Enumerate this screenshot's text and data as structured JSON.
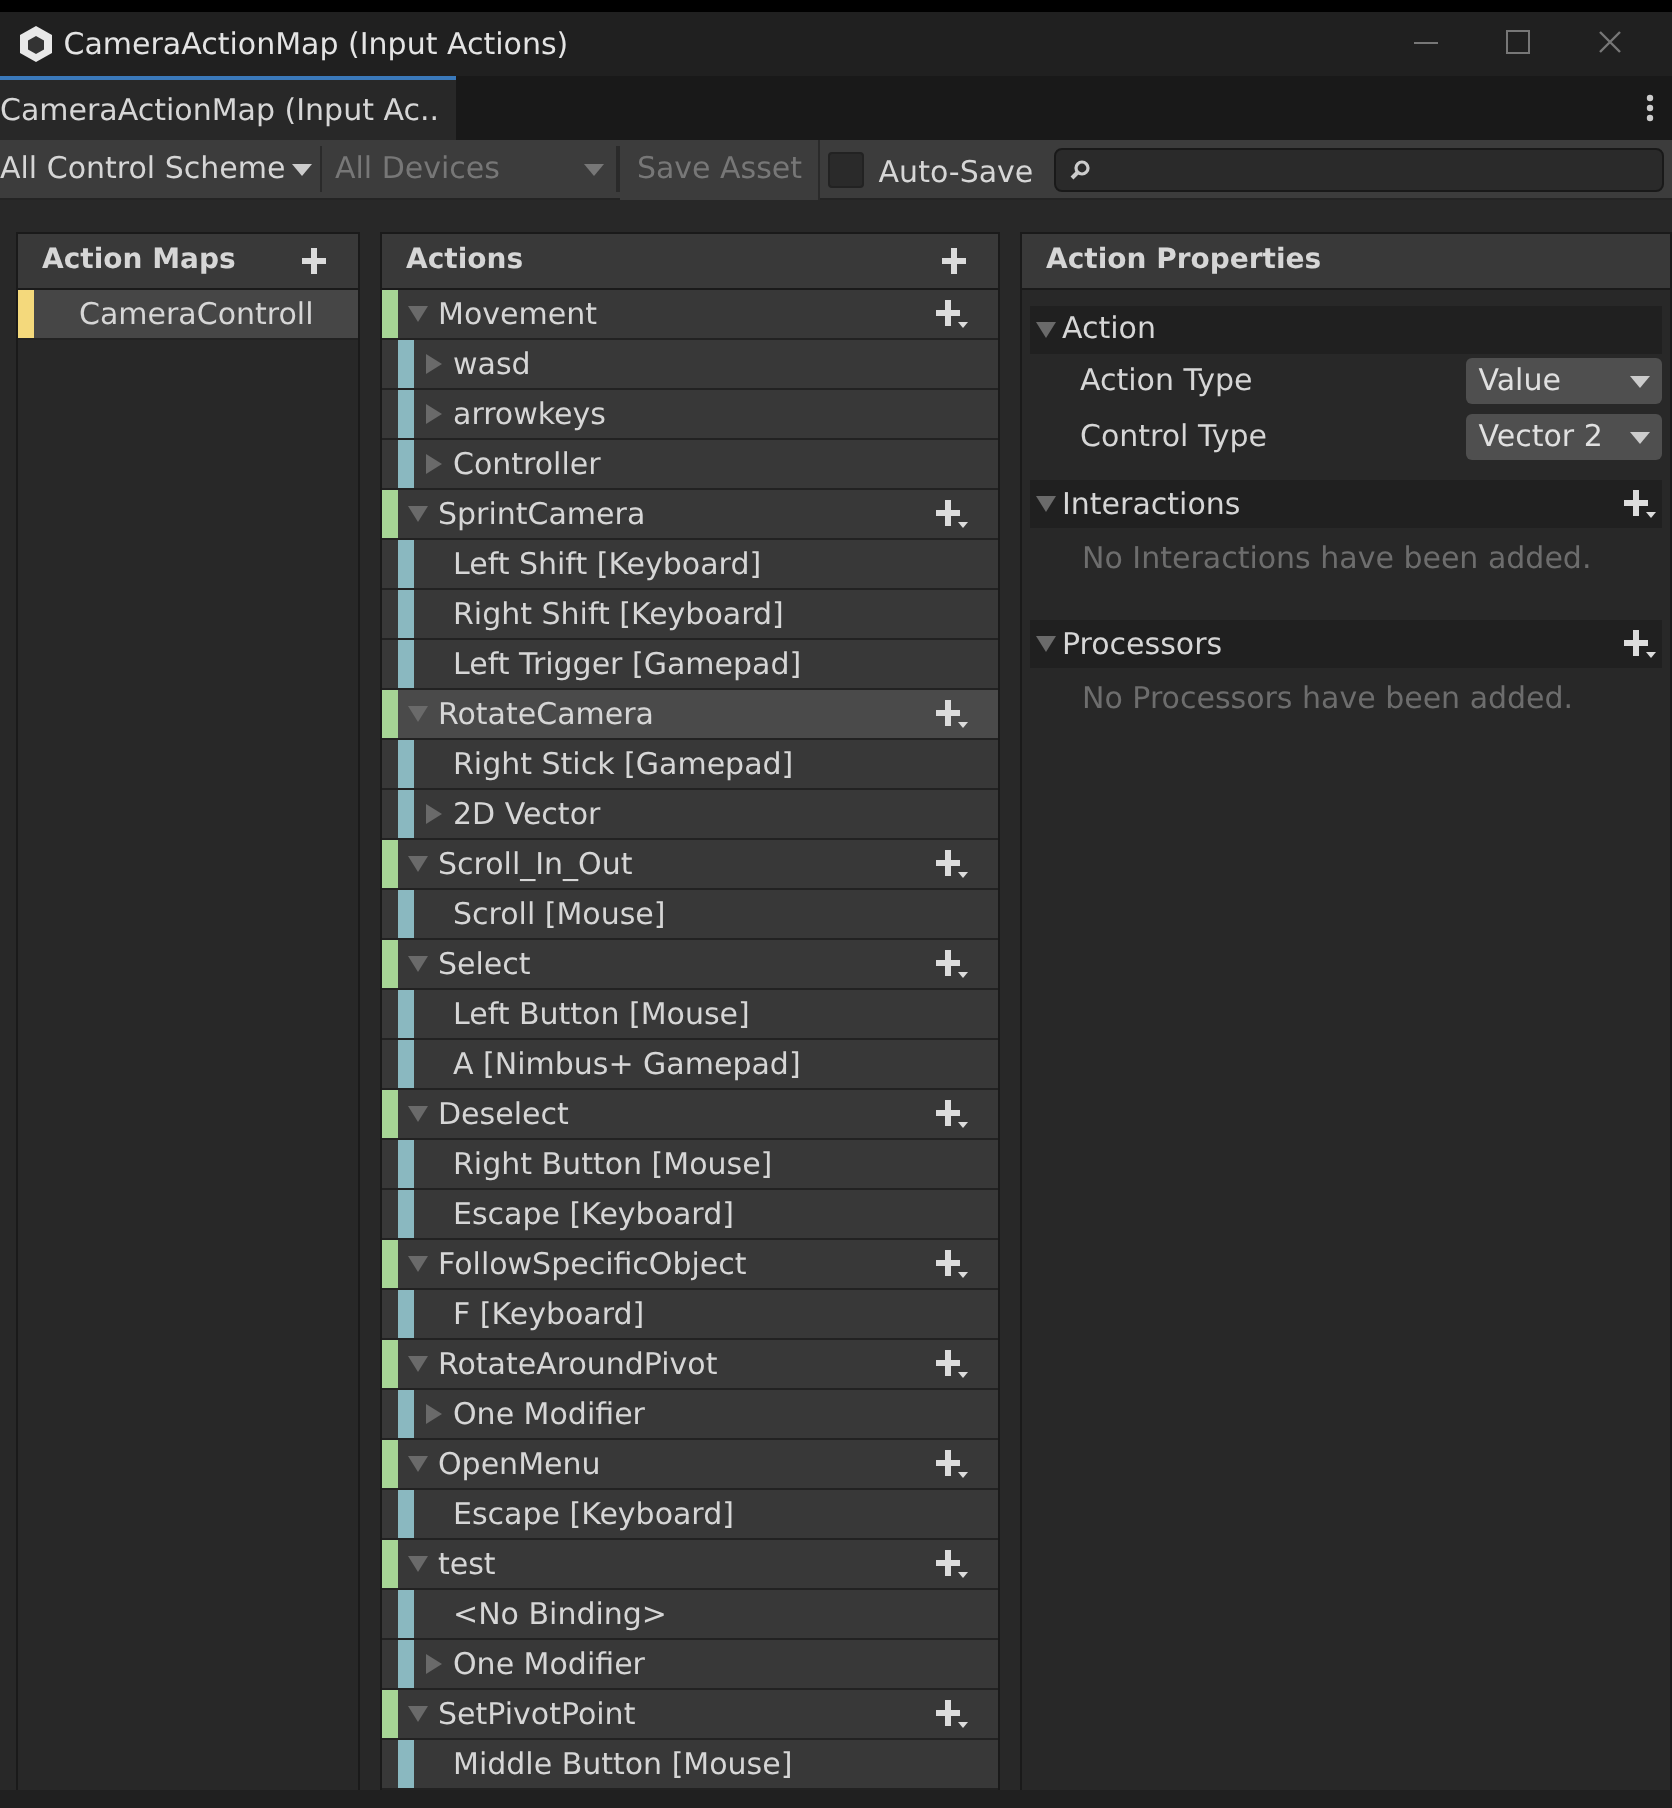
{
  "window": {
    "title": "CameraActionMap (Input Actions)"
  },
  "tabs": [
    {
      "label": "CameraActionMap (Input Ac..",
      "selected": true
    }
  ],
  "toolbar": {
    "control_scheme": "All Control Scheme",
    "devices": "All Devices",
    "save_button": "Save Asset",
    "auto_save": {
      "label": "Auto-Save",
      "checked": false
    }
  },
  "action_maps": {
    "title": "Action Maps",
    "items": [
      {
        "label": "CameraControll",
        "selected": true
      }
    ]
  },
  "actions": {
    "title": "Actions",
    "items": [
      {
        "label": "Movement",
        "expanded": true,
        "selected": false,
        "children": [
          {
            "kind": "composite",
            "label": "wasd",
            "expanded": false
          },
          {
            "kind": "composite",
            "label": "arrowkeys",
            "expanded": false
          },
          {
            "kind": "composite",
            "label": "Controller",
            "expanded": false
          }
        ]
      },
      {
        "label": "SprintCamera",
        "expanded": true,
        "selected": false,
        "children": [
          {
            "kind": "binding",
            "label": "Left Shift [Keyboard]"
          },
          {
            "kind": "binding",
            "label": "Right Shift [Keyboard]"
          },
          {
            "kind": "binding",
            "label": "Left Trigger [Gamepad]"
          }
        ]
      },
      {
        "label": "RotateCamera",
        "expanded": true,
        "selected": true,
        "children": [
          {
            "kind": "binding",
            "label": "Right Stick [Gamepad]"
          },
          {
            "kind": "composite",
            "label": "2D Vector",
            "expanded": false
          }
        ]
      },
      {
        "label": "Scroll_In_Out",
        "expanded": true,
        "selected": false,
        "children": [
          {
            "kind": "binding",
            "label": "Scroll [Mouse]"
          }
        ]
      },
      {
        "label": "Select",
        "expanded": true,
        "selected": false,
        "children": [
          {
            "kind": "binding",
            "label": "Left Button [Mouse]"
          },
          {
            "kind": "binding",
            "label": "A [Nimbus+ Gamepad]"
          }
        ]
      },
      {
        "label": "Deselect",
        "expanded": true,
        "selected": false,
        "children": [
          {
            "kind": "binding",
            "label": "Right Button [Mouse]"
          },
          {
            "kind": "binding",
            "label": "Escape [Keyboard]"
          }
        ]
      },
      {
        "label": "FollowSpecificObject",
        "expanded": true,
        "selected": false,
        "children": [
          {
            "kind": "binding",
            "label": "F [Keyboard]"
          }
        ]
      },
      {
        "label": "RotateAroundPivot",
        "expanded": true,
        "selected": false,
        "children": [
          {
            "kind": "composite",
            "label": "One Modifier",
            "expanded": false
          }
        ]
      },
      {
        "label": "OpenMenu",
        "expanded": true,
        "selected": false,
        "children": [
          {
            "kind": "binding",
            "label": "Escape [Keyboard]"
          }
        ]
      },
      {
        "label": "test",
        "expanded": true,
        "selected": false,
        "children": [
          {
            "kind": "binding",
            "label": "<No Binding>"
          },
          {
            "kind": "composite",
            "label": "One Modifier",
            "expanded": false
          }
        ]
      },
      {
        "label": "SetPivotPoint",
        "expanded": true,
        "selected": false,
        "children": [
          {
            "kind": "binding",
            "label": "Middle Button [Mouse]"
          }
        ]
      }
    ]
  },
  "properties": {
    "title": "Action Properties",
    "sections": [
      {
        "title": "Action",
        "expanded": true,
        "fields": [
          {
            "label": "Action Type",
            "value": "Value"
          },
          {
            "label": "Control Type",
            "value": "Vector 2"
          }
        ]
      },
      {
        "title": "Interactions",
        "expanded": true,
        "empty_text": "No Interactions have been added."
      },
      {
        "title": "Processors",
        "expanded": true,
        "empty_text": "No Processors have been added."
      }
    ]
  }
}
